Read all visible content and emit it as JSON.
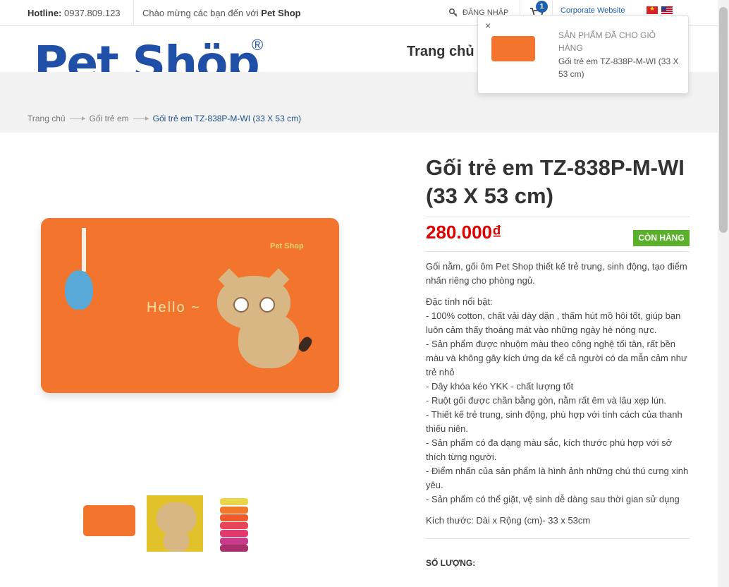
{
  "topbar": {
    "hotline_label": "Hotline:",
    "hotline_number": "0937.809.123",
    "welcome_text": "Chào mừng các bạn đến với",
    "welcome_brand": "Pet Shop",
    "login_label": "ĐĂNG NHẬP",
    "cart_count": "1",
    "corporate_label": "Corporate Website"
  },
  "header": {
    "logo_text": "Pet Shöp",
    "logo_reg": "®",
    "nav_home": "Trang chủ"
  },
  "breadcrumb": [
    "Trang chủ",
    "Gối trẻ em",
    "Gối trẻ em TZ-838P-M-WI (33 X 53 cm)"
  ],
  "product": {
    "title": "Gối trẻ em TZ-838P-M-WI (33 X 53 cm)",
    "price": "280.000₫",
    "stock": "CÒN HÀNG",
    "intro": "Gối nằm, gối ôm Pet Shop thiết kế trẻ trung, sinh động, tạo điểm nhấn riêng cho phòng ngủ.",
    "features": [
      "Đặc tính nổi bật:",
      "- 100% cotton, chất vải dày dặn , thấm hút mồ hôi tốt, giúp bạn luôn cảm thấy thoáng mát vào những ngày hè nóng nực.",
      "- Sản phẩm được nhuộm màu theo công nghệ tối tân, rất bền màu và không gây kích ứng da kể cả người có da mẫn cảm như trẻ nhỏ",
      "- Dây khóa kéo YKK - chất lượng tốt",
      "- Ruột gối được chần bằng gòn, nằm rất êm và lâu xẹp lún.",
      "- Thiết kế trẻ trung, sinh động, phù hợp với tính cách của thanh thiếu niên.",
      "- Sản phẩm có đa dạng màu sắc, kích thước phù hợp với sở thích từng người.",
      "- Điểm nhấn của sản phẩm là hình ảnh những chú thú cưng xinh yêu.",
      "- Sản phẩm có thể giặt, vệ sinh dễ dàng sau thời gian sử dụng"
    ],
    "size": "Kích thước: Dài x Rộng (cm)- 33 x 53cm",
    "quantity_label": "SỐ LƯỢNG:",
    "image_brand": "Pet Shop",
    "image_hello": "Hello ~"
  },
  "popup": {
    "close": "×",
    "heading": "SẢN PHẨM ĐÃ CHO GIỎ HÀNG",
    "item_name": "Gối trẻ em TZ-838P-M-WI (33 X 53 cm)"
  },
  "colors": {
    "brand_blue": "#1f4fa6",
    "price_red": "#e10000",
    "stock_green": "#5aaf2b",
    "pillow_orange": "#f2742d"
  }
}
